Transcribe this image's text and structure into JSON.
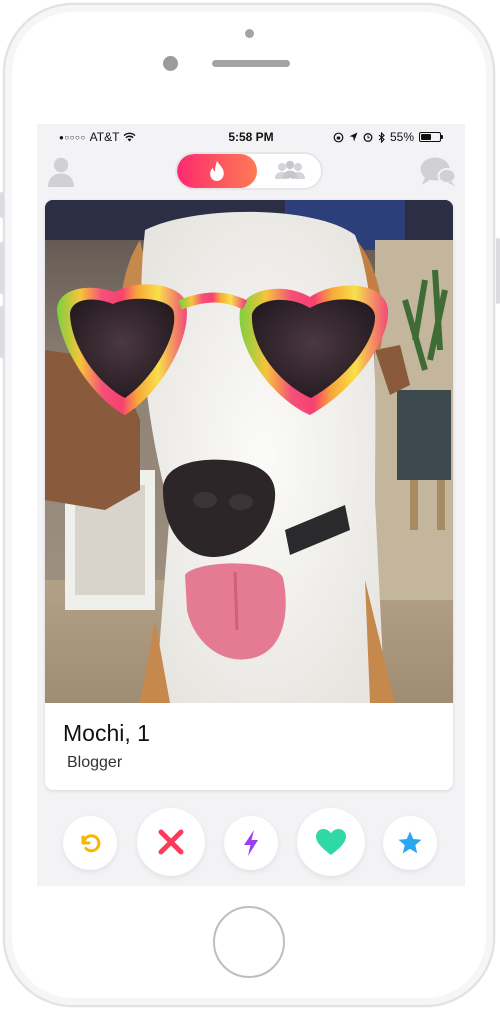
{
  "status_bar": {
    "signal": "●○○○○",
    "carrier": "AT&T",
    "time": "5:58 PM",
    "battery": "55%",
    "battery_level": 0.55
  },
  "top_nav": {
    "left_icon": "profile-icon",
    "center_toggle": [
      "flame-icon",
      "group-icon"
    ],
    "right_icon": "chat-icon",
    "accent": "#fd4a65"
  },
  "card": {
    "name": "Mochi, 1",
    "bio": "Blogger"
  },
  "actions": [
    {
      "icon": "rewind-icon",
      "color": "#f5b700"
    },
    {
      "icon": "nope-x-icon",
      "color": "#fd3a5c"
    },
    {
      "icon": "boost-bolt-icon",
      "color": "#9b3df0"
    },
    {
      "icon": "like-heart-icon",
      "color": "#2fd8a6"
    },
    {
      "icon": "super-like-star-icon",
      "color": "#2aa7f0"
    }
  ]
}
